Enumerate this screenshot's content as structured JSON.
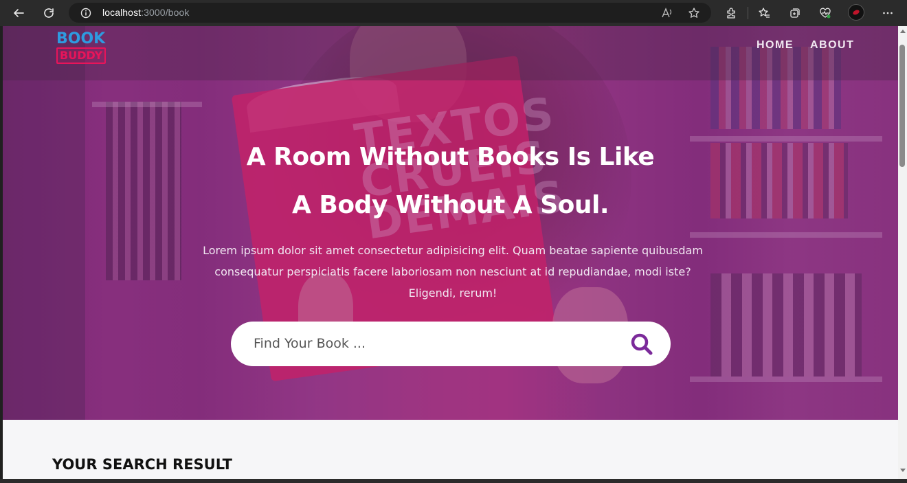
{
  "browser": {
    "url_host": "localhost",
    "url_path": ":3000/book",
    "back_icon": "arrow-left-icon",
    "reload_icon": "reload-icon",
    "info_icon": "info-circle-icon"
  },
  "navbar": {
    "logo_top": "BOOK",
    "logo_bottom": "BUDDY",
    "links": [
      "HOME",
      "ABOUT"
    ]
  },
  "hero": {
    "title_line1": "A Room Without Books Is Like",
    "title_line2": "A Body Without A Soul.",
    "description": "Lorem ipsum dolor sit amet consectetur adipisicing elit. Quam beatae sapiente quibusdam consequatur perspiciatis facere laboriosam non nesciunt at id repudiandae, modi iste? Eligendi, rerum!",
    "search_placeholder": "Find Your Book ...",
    "book_cover_text": "TEXTOS CRUEIS DEMAIS"
  },
  "results": {
    "title": "YOUR SEARCH RESULT"
  },
  "colors": {
    "accent": "#7b2a9a",
    "logo_blue": "#2e9be0",
    "logo_pink": "#e8145a",
    "overlay": "#962d8c"
  }
}
